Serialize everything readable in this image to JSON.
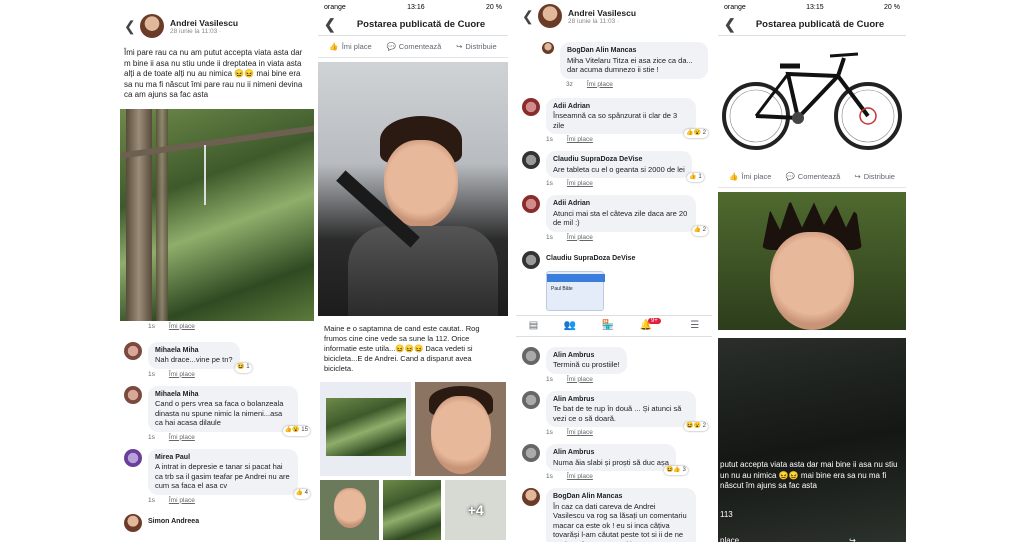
{
  "panel1": {
    "author": "Andrei Vasilescu",
    "date": "28 iunie la 11:03 · ",
    "post_text": "Îmi pare rau ca nu am putut accepta viata asta dar m bine ii asa nu stiu unde ii dreptatea in viata asta alți a de toate alți nu au nimica 😖😖  mai bine era sa nu ma fi născut îmi pare rau nu ii nimeni devina ca am ajuns sa fac asta",
    "like_row": {
      "time": "1s",
      "like": "Îmi place"
    },
    "comments": [
      {
        "name": "Mihaela Miha",
        "text": "Nah drace...vine pe tn?",
        "time": "1s",
        "like": "Îmi place",
        "react": "😆 1"
      },
      {
        "name": "Mihaela Miha",
        "text": "Cand o pers vrea sa faca o bolanzeala dinasta nu spune nimic la nimeni...asa ca hai acasa dilaule",
        "time": "1s",
        "like": "Îmi place",
        "react": "👍😮 15"
      },
      {
        "name": "Mirea Paul",
        "text": "A intrat in depresie e tanar si pacat hai ca trb sa il gasim teafar pe Andrei nu are cum sa faca el asa cv",
        "time": "1s",
        "like": "Îmi place",
        "react": "👍 4"
      },
      {
        "name": "Simon Andreea",
        "text": "",
        "time": "",
        "like": "",
        "react": ""
      }
    ]
  },
  "panel2": {
    "status": {
      "carrier": "orange",
      "time": "13:16",
      "battery": "20 %"
    },
    "nav_title": "Postarea publicată de Cuore",
    "actions": {
      "like": "Îmi place",
      "comment": "Comentează",
      "share": "Distribuie"
    },
    "post_text": "Maine e o saptamna de cand este cautat.. Rog frumos cine cine vede sa sune la 112. Orice informatie este utila...😖😖😖 Daca vedeti si bicicleta...E de Andrei. Cand a disparut avea bicicleta.",
    "thumb_count": "+4"
  },
  "panel3": {
    "author": "Andrei Vasilescu",
    "date": "28 iunie la 11:03 · ",
    "comments": [
      {
        "name": "BogDan Alin Mancas",
        "text": "Miha Vitelaru Titza ei asa zice ca da... dar acuma dumnezo ii stie !",
        "time": "3z",
        "like": "Îmi place",
        "react": ""
      },
      {
        "name": "Adii Adrian",
        "text": "Înseamnă ca so spânzurat ii clar de 3 zile",
        "time": "1s",
        "like": "Îmi place",
        "react": "👍😮 2"
      },
      {
        "name": "Claudiu SupraDoza DeVise",
        "text": "Are tableta cu el o geanta si 2000 de lei",
        "time": "1s",
        "like": "Îmi place",
        "react": "👍 1"
      },
      {
        "name": "Adii Adrian",
        "text": "Atunci mai sta el câteva zile daca are 20 de mil :)",
        "time": "1s",
        "like": "Îmi place",
        "react": "👍 2"
      },
      {
        "name": "Claudiu SupraDoza DeVise",
        "text": "",
        "time": "",
        "like": "",
        "react": ""
      }
    ],
    "embedded_card": {
      "name": "Paul Bâte"
    },
    "tab_badge": "9+",
    "comments2": [
      {
        "name": "Alin Ambrus",
        "text": "Termină cu prostiile!",
        "time": "1s",
        "like": "Îmi place",
        "react": ""
      },
      {
        "name": "Alin Ambrus",
        "text": "Te bat de te rup în două ... Și atunci să vezi ce o să doară.",
        "time": "1s",
        "like": "Îmi place",
        "react": "😆😮 2"
      },
      {
        "name": "Alin Ambrus",
        "text": "Numa ăia slabi și proști să duc așa",
        "time": "1s",
        "like": "Îmi place",
        "react": "😆👍 3"
      },
      {
        "name": "BogDan Alin Mancas",
        "text": "În caz ca dati careva de Andrei Vasilescu va rog sa lăsați un comentariu macar ca este ok ! eu si inca câțiva tovarăși l-am căutat peste tot si ii de ne gasit ! a fost anunțat si la",
        "time": "",
        "like": "",
        "react": ""
      }
    ]
  },
  "panel4": {
    "status": {
      "carrier": "orange",
      "time": "13:15",
      "battery": "20 %"
    },
    "nav_title": "Postarea publicată de Cuore",
    "actions": {
      "like": "Îmi place",
      "comment": "Comentează",
      "share": "Distribuie"
    },
    "overlay_text": "putut accepta viata asta dar mai bine ii asa nu stiu un nu au nimica 😖😖  mai bine era sa nu ma fi născut îm ajuns sa fac asta",
    "overlay_count": "113",
    "overlay_like": "place"
  },
  "colors": {
    "accent": "#1877f2",
    "bubble": "#f0f2f5",
    "badge": "#e41e3f"
  }
}
